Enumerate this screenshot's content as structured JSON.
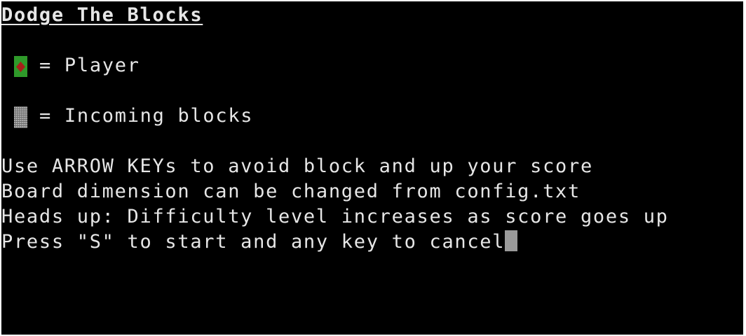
{
  "terminal": {
    "title": "Dodge The Blocks",
    "legend": {
      "player": {
        "icon": "red-diamond-on-green-icon",
        "text": "= Player",
        "swatch_color": "#2f9a2a",
        "diamond_color": "#a8201a"
      },
      "blocks": {
        "icon": "shaded-block-icon",
        "text": "= Incoming blocks",
        "swatch_color": "#8e8e8e"
      }
    },
    "instructions": [
      "Use ARROW KEYs to avoid block and up your score",
      "Board dimension can be changed from config.txt",
      "Heads up: Difficulty level increases as score goes up",
      "Press \"S\" to start and any key to cancel"
    ],
    "colors": {
      "background": "#000000",
      "text": "#e6e6e6",
      "cursor": "#9a9a9a"
    }
  }
}
